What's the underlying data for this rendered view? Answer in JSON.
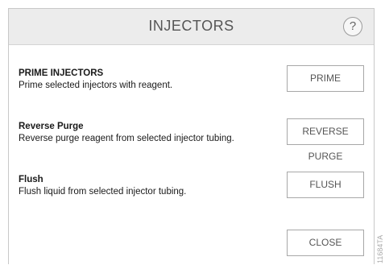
{
  "dialog": {
    "title": "INJECTORS",
    "help_label": "?"
  },
  "actions": [
    {
      "heading": "PRIME INJECTORS",
      "description": "Prime selected injectors with reagent.",
      "button_label": "PRIME"
    },
    {
      "heading": "Reverse Purge",
      "description": "Reverse purge reagent from selected injector tubing.",
      "button_label": "REVERSE PURGE"
    },
    {
      "heading": "Flush",
      "description": "Flush liquid from selected injector tubing.",
      "button_label": "FLUSH"
    }
  ],
  "footer": {
    "close_label": "CLOSE"
  },
  "figure_id": "11684TA",
  "colors": {
    "header_bg": "#ececec",
    "border": "#c8c8c8",
    "button_text": "#555555"
  }
}
